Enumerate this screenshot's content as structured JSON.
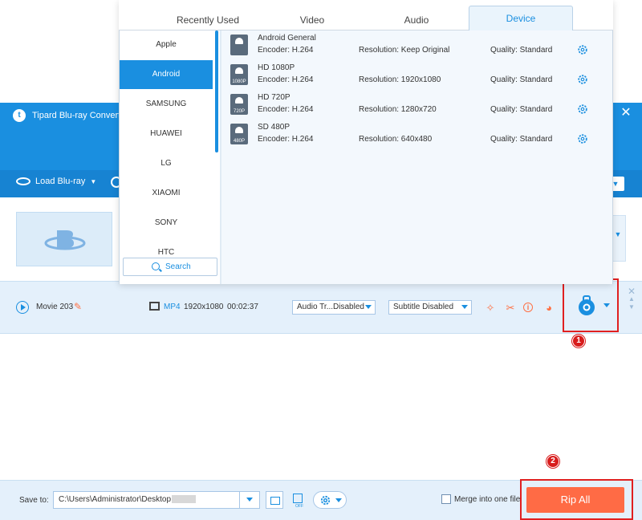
{
  "app": {
    "title": "Tipard Blu-ray Converter",
    "logo_letter": "t",
    "minimize": "—",
    "close": "✕"
  },
  "toolbar": {
    "load_label": "Load Blu-ray",
    "load_arrow": "▼",
    "right_arrow": "▼"
  },
  "movie": {
    "name": "Movie 203",
    "format": "MP4",
    "resolution": "1920x1080",
    "duration": "00:02:37",
    "audio_track": "Audio Tr...Disabled",
    "subtitle": "Subtitle Disabled",
    "close": "✕",
    "up": "▲",
    "down": "▼"
  },
  "annotations": {
    "badge_1": "1",
    "badge_2": "2"
  },
  "footer": {
    "save_to_label": "Save to:",
    "save_path": "C:\\Users\\Administrator\\Desktop",
    "hw_off": "OFF",
    "merge_label": "Merge into one file",
    "merge_checked": false,
    "rip_all": "Rip All"
  },
  "popup": {
    "tabs": [
      {
        "label": "Recently Used"
      },
      {
        "label": "Video"
      },
      {
        "label": "Audio"
      },
      {
        "label": "Device",
        "active": true
      }
    ],
    "categories": [
      {
        "label": "Apple"
      },
      {
        "label": "Android",
        "selected": true
      },
      {
        "label": "SAMSUNG"
      },
      {
        "label": "HUAWEI"
      },
      {
        "label": "LG"
      },
      {
        "label": "XIAOMI"
      },
      {
        "label": "SONY"
      },
      {
        "label": "HTC"
      }
    ],
    "search_label": "Search",
    "profiles": [
      {
        "name": "Android General",
        "badge": "",
        "encoder": "Encoder: H.264",
        "resolution": "Resolution: Keep Original",
        "quality": "Quality: Standard"
      },
      {
        "name": "HD 1080P",
        "badge": "1080P",
        "encoder": "Encoder: H.264",
        "resolution": "Resolution: 1920x1080",
        "quality": "Quality: Standard"
      },
      {
        "name": "HD 720P",
        "badge": "720P",
        "encoder": "Encoder: H.264",
        "resolution": "Resolution: 1280x720",
        "quality": "Quality: Standard"
      },
      {
        "name": "SD 480P",
        "badge": "480P",
        "encoder": "Encoder: H.264",
        "resolution": "Resolution: 640x480",
        "quality": "Quality: Standard"
      }
    ]
  },
  "colors": {
    "brand_blue": "#1a8fe0",
    "accent_orange": "#ff6b45",
    "annotation_red": "#e02020"
  }
}
